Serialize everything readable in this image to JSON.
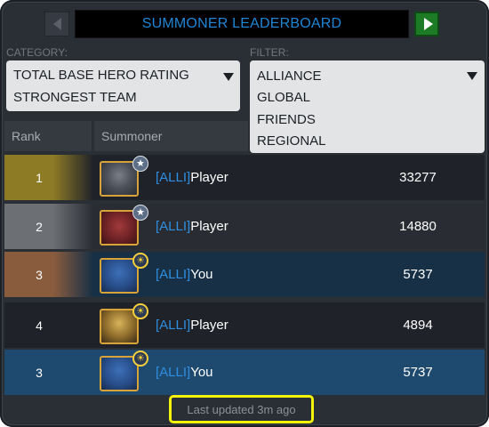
{
  "header": {
    "title": "SUMMONER LEADERBOARD",
    "prev_icon": "triangle-left-icon",
    "next_icon": "triangle-right-icon"
  },
  "category": {
    "label": "CATEGORY:",
    "options": [
      "TOTAL BASE HERO RATING",
      "STRONGEST TEAM"
    ],
    "caret_icon": "caret-down-icon"
  },
  "filter": {
    "label": "FILTER:",
    "options": [
      "ALLIANCE",
      "GLOBAL",
      "FRIENDS",
      "REGIONAL"
    ],
    "caret_icon": "caret-down-icon"
  },
  "table": {
    "columns": [
      "Rank",
      "Summoner"
    ],
    "rows": [
      {
        "rank": "1",
        "tag": "[ALLI]",
        "name": "Player",
        "rating": "33277",
        "badge": "star-badge-icon",
        "accent": "#8e7b26",
        "bg": "#1f2228"
      },
      {
        "rank": "2",
        "tag": "[ALLI]",
        "name": "Player",
        "rating": "14880",
        "badge": "star-badge-icon",
        "accent": "#6c7074",
        "bg": "#292c32"
      },
      {
        "rank": "3",
        "tag": "[ALLI]",
        "name": "You",
        "rating": "5737",
        "badge": "sun-badge-icon",
        "accent": "#8a5c3e",
        "bg": "#173045"
      },
      {
        "rank": "4",
        "tag": "[ALLI]",
        "name": "Player",
        "rating": "4894",
        "badge": "sun-badge-icon",
        "accent": "#1f2228",
        "bg": "#1f2228"
      },
      {
        "rank": "3",
        "tag": "[ALLI]",
        "name": "You",
        "rating": "5737",
        "badge": "sun-badge-icon",
        "accent": "#1f4a70",
        "bg": "#1f4a70"
      }
    ]
  },
  "footer": {
    "text": "Last updated 3m ago",
    "highlight_color": "#f2f20a"
  },
  "colors": {
    "accent_blue": "#2f8ee0",
    "play_green": "#1d7b25"
  }
}
